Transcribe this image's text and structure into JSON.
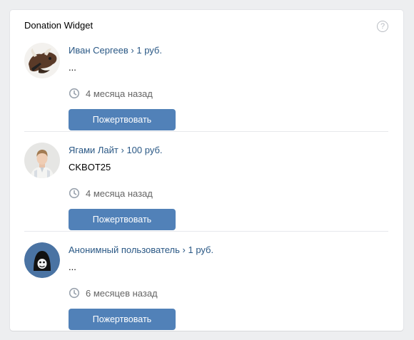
{
  "widget": {
    "title": "Donation Widget",
    "help_icon": "question-circle-icon",
    "help_glyph": "?"
  },
  "donations": [
    {
      "name": "Иван Сергеев",
      "separator": " › ",
      "amount": "1 руб.",
      "message": "...",
      "time": "4 месяца назад",
      "button_label": "Пожертвовать",
      "avatar_icon": "bull-avatar"
    },
    {
      "name": "Ягами Лайт",
      "separator": " › ",
      "amount": "100 руб.",
      "message": "CKBOT25",
      "time": "4 месяца назад",
      "button_label": "Пожертвовать",
      "avatar_icon": "person-photo-avatar"
    },
    {
      "name": "Анонимный пользователь",
      "separator": " › ",
      "amount": "1 руб.",
      "message": "...",
      "time": "6 месяцев назад",
      "button_label": "Пожертвовать",
      "avatar_icon": "anonymous-avatar"
    }
  ],
  "colors": {
    "link": "#2a5885",
    "button": "#5181b8",
    "muted": "#656565",
    "anon_bg": "#4a73a3"
  }
}
